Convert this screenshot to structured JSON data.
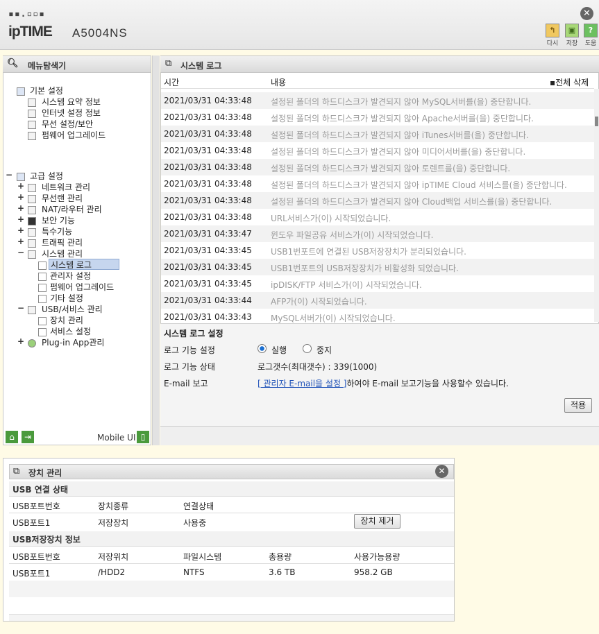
{
  "header": {
    "logo_dots": "▪▪.▫▫▪",
    "logo_text": "ipTIME",
    "model": "A5004NS",
    "toolbar": [
      {
        "icon": "refresh-icon",
        "label": "다시",
        "color": "#d6a83a"
      },
      {
        "icon": "save-icon",
        "label": "저장",
        "color": "#7ab648"
      },
      {
        "icon": "help-icon",
        "label": "도움",
        "color": "#4aa845"
      }
    ]
  },
  "sidebar": {
    "title": "메뉴탐색기",
    "basic": {
      "label": "기본 설정",
      "items": [
        "시스템 요약 정보",
        "인터넷 설정 정보",
        "무선 설정/보안",
        "펌웨어 업그레이드"
      ]
    },
    "advanced": {
      "label": "고급 설정",
      "items": [
        "네트워크 관리",
        "무선랜 관리",
        "NAT/라우터 관리",
        "보안 기능",
        "특수기능",
        "트래픽 관리",
        "시스템 관리"
      ],
      "system_sub": [
        "시스템 로그",
        "관리자 설정",
        "펌웨어 업그레이드",
        "기타 설정"
      ],
      "usb": "USB/서비스 관리",
      "usb_sub": [
        "장치 관리",
        "서비스 설정"
      ],
      "plugin": "Plug-in App관리"
    },
    "footer": {
      "mobile_ui": "Mobile UI"
    }
  },
  "syslog": {
    "title": "시스템 로그",
    "col_time": "시간",
    "col_content": "내용",
    "delete_all": "전체 삭제",
    "rows": [
      {
        "time": "2021/03/31 04:33:48",
        "msg": "설정된 폴더의 하드디스크가 발견되지 않아 MySQL서버를(을) 중단합니다."
      },
      {
        "time": "2021/03/31 04:33:48",
        "msg": "설정된 폴더의 하드디스크가 발견되지 않아 Apache서버를(을) 중단합니다."
      },
      {
        "time": "2021/03/31 04:33:48",
        "msg": "설정된 폴더의 하드디스크가 발견되지 않아 iTunes서버를(을) 중단합니다."
      },
      {
        "time": "2021/03/31 04:33:48",
        "msg": "설정된 폴더의 하드디스크가 발견되지 않아 미디어서버를(을) 중단합니다."
      },
      {
        "time": "2021/03/31 04:33:48",
        "msg": "설정된 폴더의 하드디스크가 발견되지 않아 토렌트를(을) 중단합니다."
      },
      {
        "time": "2021/03/31 04:33:48",
        "msg": "설정된 폴더의 하드디스크가 발견되지 않아 ipTIME Cloud 서비스를(을) 중단합니다."
      },
      {
        "time": "2021/03/31 04:33:48",
        "msg": "설정된 폴더의 하드디스크가 발견되지 않아 Cloud백업 서비스를(을) 중단합니다."
      },
      {
        "time": "2021/03/31 04:33:48",
        "msg": "URL서비스가(이) 시작되었습니다."
      },
      {
        "time": "2021/03/31 04:33:47",
        "msg": "윈도우 파일공유 서비스가(이) 시작되었습니다."
      },
      {
        "time": "2021/03/31 04:33:45",
        "msg": "USB1번포트에 연결된 USB저장장치가 분리되었습니다."
      },
      {
        "time": "2021/03/31 04:33:45",
        "msg": "USB1번포트의 USB저장장치가 비활성화 되었습니다."
      },
      {
        "time": "2021/03/31 04:33:45",
        "msg": "ipDISK/FTP 서비스가(이) 시작되었습니다."
      },
      {
        "time": "2021/03/31 04:33:44",
        "msg": "AFP가(이) 시작되었습니다."
      },
      {
        "time": "2021/03/31 04:33:43",
        "msg": "MySQL서버가(이) 시작되었습니다."
      }
    ]
  },
  "settings": {
    "title": "시스템 로그 설정",
    "log_func_label": "로그 기능 설정",
    "run_label": "실행",
    "stop_label": "중지",
    "selected": "실행",
    "status_label": "로그 기능 상태",
    "status_value": "로그갯수(최대갯수) : 339(1000)",
    "email_label": "E-mail 보고",
    "email_link": "[ 관리자 E-mail을 설정 ]",
    "email_text": "하여야 E-mail 보고기능을 사용할수 있습니다.",
    "apply": "적용"
  },
  "device": {
    "title": "장치 관리",
    "usb_status_title": "USB 연결 상태",
    "status_headers": [
      "USB포트번호",
      "장치종류",
      "연결상태"
    ],
    "status_row": {
      "port": "USB포트1",
      "type": "저장장치",
      "state": "사용중",
      "remove_btn": "장치 제거"
    },
    "storage_title": "USB저장장치 정보",
    "storage_headers": [
      "USB포트번호",
      "저장위치",
      "파일시스템",
      "총용량",
      "사용가능용량"
    ],
    "storage_row": [
      "USB포트1",
      "/HDD2",
      "NTFS",
      "3.6 TB",
      "958.2 GB"
    ]
  }
}
